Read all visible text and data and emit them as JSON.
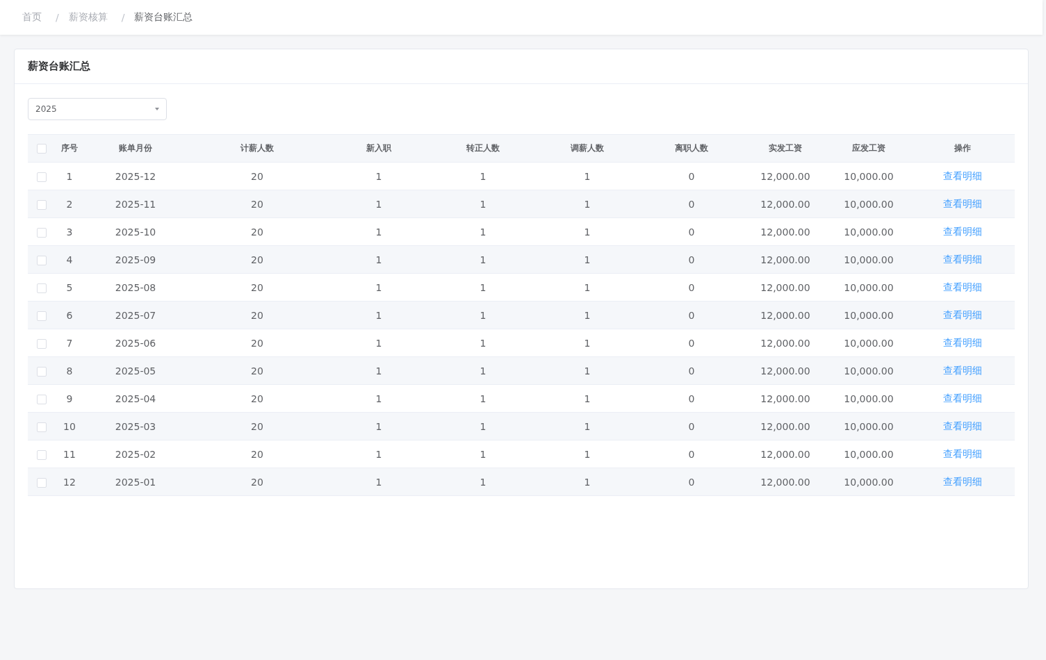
{
  "breadcrumb": [
    {
      "label": "首页",
      "current": false
    },
    {
      "label": "薪资核算",
      "current": false
    },
    {
      "label": "薪资台账汇总",
      "current": true
    }
  ],
  "breadcrumb_separator": "/",
  "card": {
    "title": "薪资台账汇总"
  },
  "year_select": {
    "value": "2025"
  },
  "table": {
    "select_all_checked": false,
    "columns": [
      "序号",
      "账单月份",
      "计薪人数",
      "新入职",
      "转正人数",
      "调薪人数",
      "离职人数",
      "实发工资",
      "应发工资",
      "操作"
    ],
    "rows": [
      {
        "checked": false,
        "cells": [
          "1",
          "2025-12",
          "20",
          "1",
          "1",
          "1",
          "0",
          "12,000.00",
          "10,000.00"
        ],
        "action": "查看明细"
      },
      {
        "checked": false,
        "cells": [
          "2",
          "2025-11",
          "20",
          "1",
          "1",
          "1",
          "0",
          "12,000.00",
          "10,000.00"
        ],
        "action": "查看明细"
      },
      {
        "checked": false,
        "cells": [
          "3",
          "2025-10",
          "20",
          "1",
          "1",
          "1",
          "0",
          "12,000.00",
          "10,000.00"
        ],
        "action": "查看明细"
      },
      {
        "checked": false,
        "cells": [
          "4",
          "2025-09",
          "20",
          "1",
          "1",
          "1",
          "0",
          "12,000.00",
          "10,000.00"
        ],
        "action": "查看明细"
      },
      {
        "checked": false,
        "cells": [
          "5",
          "2025-08",
          "20",
          "1",
          "1",
          "1",
          "0",
          "12,000.00",
          "10,000.00"
        ],
        "action": "查看明细"
      },
      {
        "checked": false,
        "cells": [
          "6",
          "2025-07",
          "20",
          "1",
          "1",
          "1",
          "0",
          "12,000.00",
          "10,000.00"
        ],
        "action": "查看明细"
      },
      {
        "checked": false,
        "cells": [
          "7",
          "2025-06",
          "20",
          "1",
          "1",
          "1",
          "0",
          "12,000.00",
          "10,000.00"
        ],
        "action": "查看明细"
      },
      {
        "checked": false,
        "cells": [
          "8",
          "2025-05",
          "20",
          "1",
          "1",
          "1",
          "0",
          "12,000.00",
          "10,000.00"
        ],
        "action": "查看明细"
      },
      {
        "checked": false,
        "cells": [
          "9",
          "2025-04",
          "20",
          "1",
          "1",
          "1",
          "0",
          "12,000.00",
          "10,000.00"
        ],
        "action": "查看明细"
      },
      {
        "checked": false,
        "cells": [
          "10",
          "2025-03",
          "20",
          "1",
          "1",
          "1",
          "0",
          "12,000.00",
          "10,000.00"
        ],
        "action": "查看明细"
      },
      {
        "checked": false,
        "cells": [
          "11",
          "2025-02",
          "20",
          "1",
          "1",
          "1",
          "0",
          "12,000.00",
          "10,000.00"
        ],
        "action": "查看明细"
      },
      {
        "checked": false,
        "cells": [
          "12",
          "2025-01",
          "20",
          "1",
          "1",
          "1",
          "0",
          "12,000.00",
          "10,000.00"
        ],
        "action": "查看明细"
      }
    ]
  }
}
